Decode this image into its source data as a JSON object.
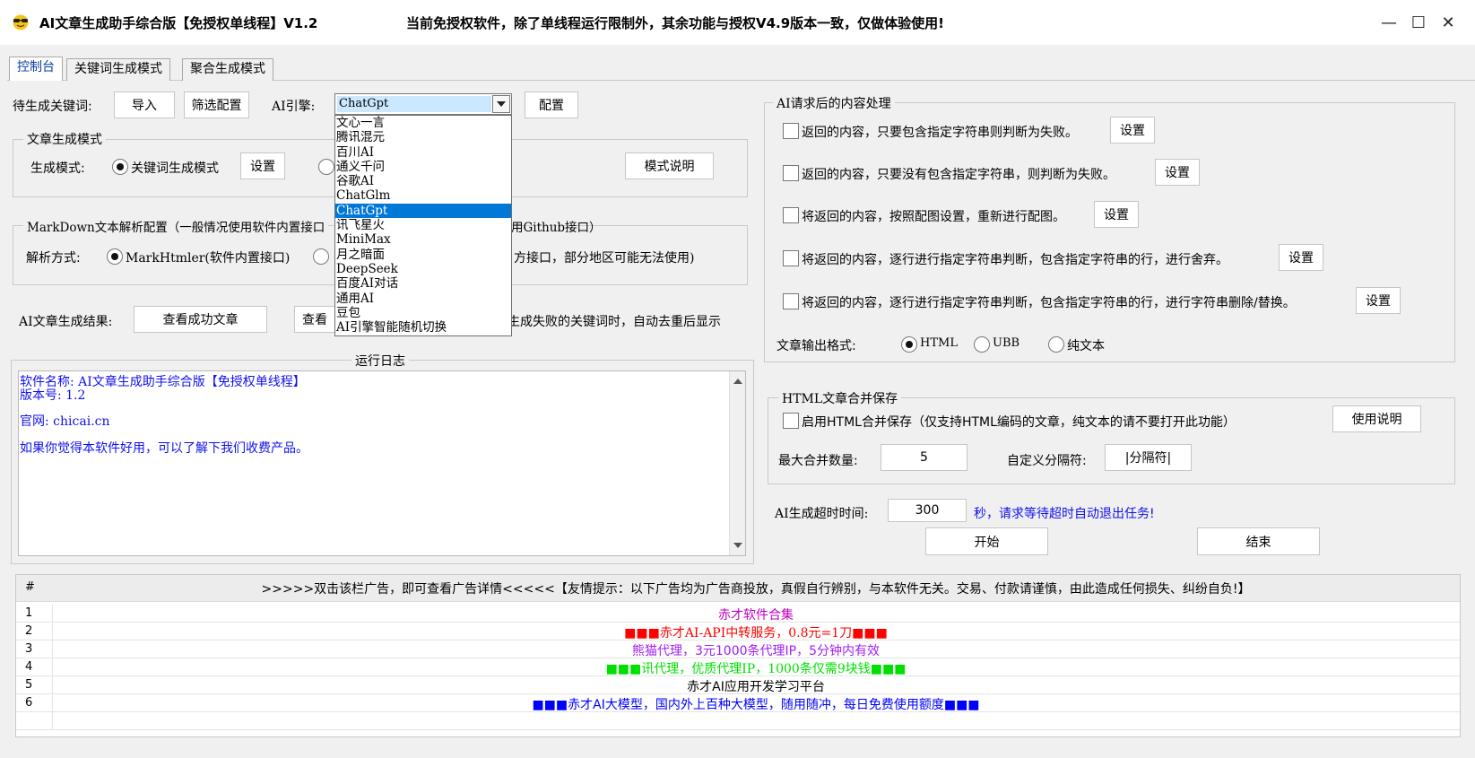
{
  "window": {
    "title": "AI文章生成助手综合版【免授权单线程】V1.2",
    "notice": "当前免授权软件，除了单线程运行限制外，其余功能与授权V4.9版本一致，仅做体验使用!",
    "controls": {
      "minimize": "—",
      "maximize": "☐",
      "close": "✕"
    }
  },
  "tabs": [
    {
      "label": "控制台"
    },
    {
      "label": "关键词生成模式"
    },
    {
      "label": "聚合生成模式"
    }
  ],
  "keywords": {
    "label": "待生成关键词:",
    "import_button": "导入",
    "filter_button": "筛选配置"
  },
  "engine": {
    "label": "AI引擎:",
    "selected": "ChatGpt",
    "config_button": "配置",
    "options": [
      "文心一言",
      "腾讯混元",
      "百川AI",
      "通义千问",
      "谷歌AI",
      "ChatGlm",
      "ChatGpt",
      "讯飞星火",
      "MiniMax",
      "月之暗面",
      "DeepSeek",
      "百度AI对话",
      "通用AI",
      "豆包",
      "AI引擎智能随机切换"
    ],
    "selected_index": 6
  },
  "gen_mode": {
    "group_title": "文章生成模式",
    "label": "生成模式:",
    "option_keyword": "关键词生成模式",
    "settings_button": "设置",
    "explain_button": "模式说明"
  },
  "markdown": {
    "group_title_left": "MarkDown文本解析配置（一般情况使用软件内置接口",
    "group_title_right": "用Github接口）",
    "label": "解析方式:",
    "option_builtin": "MarkHtmler(软件内置接口)",
    "option_github_tail": "方接口，部分地区可能无法使用)"
  },
  "result": {
    "label": "AI文章生成结果:",
    "view_success_button": "查看成功文章",
    "view_failed_partial": "查看",
    "tail_text": "生成失败的关键词时，自动去重后显示"
  },
  "log": {
    "title": "运行日志",
    "lines": [
      "软件名称: AI文章生成助手综合版【免授权单线程】",
      "版本号: 1.2",
      "官网: chicai.cn",
      "如果你觉得本软件好用，可以了解下我们收费产品。"
    ]
  },
  "post_process": {
    "group_title": "AI请求后的内容处理",
    "settings_label": "设置",
    "rules": [
      "返回的内容，只要包含指定字符串则判断为失败。",
      "返回的内容，只要没有包含指定字符串，则判断为失败。",
      "将返回的内容，按照配图设置，重新进行配图。",
      "将返回的内容，逐行进行指定字符串判断，包含指定字符串的行，进行舍弃。",
      "将返回的内容，逐行进行指定字符串判断，包含指定字符串的行，进行字符串删除/替换。"
    ],
    "output_label": "文章输出格式:",
    "output_options": [
      "HTML",
      "UBB",
      "纯文本"
    ],
    "output_selected": "HTML"
  },
  "merge": {
    "group_title": "HTML文章合并保存",
    "enable_label": "启用HTML合并保存（仅支持HTML编码的文章，纯文本的请不要打开此功能）",
    "help_button": "使用说明",
    "max_label": "最大合并数量:",
    "max_value": "5",
    "sep_label": "自定义分隔符:",
    "sep_value": "|分隔符|"
  },
  "timeout": {
    "label": "AI生成超时时间:",
    "value": "300",
    "hint": "秒，请求等待超时自动退出任务!"
  },
  "actions": {
    "start": "开始",
    "stop": "结束"
  },
  "ads": {
    "hash": "#",
    "header": ">>>>>双击该栏广告，即可查看广告详情<<<<<【友情提示：以下广告均为广告商投放，真假自行辨别，与本软件无关。交易、付款请谨慎，由此造成任何损失、纠纷自负!】",
    "rows": [
      {
        "num": "1",
        "text": "赤才软件合集",
        "color": "#c000c0"
      },
      {
        "num": "2",
        "text": "■■■赤才AI-API中转服务，0.8元=1刀■■■",
        "color": "#ff0000"
      },
      {
        "num": "3",
        "text": "熊猫代理，3元1000条代理IP，5分钟内有效",
        "color": "#a020f0"
      },
      {
        "num": "4",
        "text": "■■■讯代理，优质代理IP，1000条仅需9块钱■■■",
        "color": "#00e000"
      },
      {
        "num": "5",
        "text": "赤才AI应用开发学习平台",
        "color": "#000000"
      },
      {
        "num": "6",
        "text": "■■■赤才AI大模型，国内外上百种大模型，随用随冲，每日免费使用额度■■■",
        "color": "#0000ff"
      }
    ]
  }
}
